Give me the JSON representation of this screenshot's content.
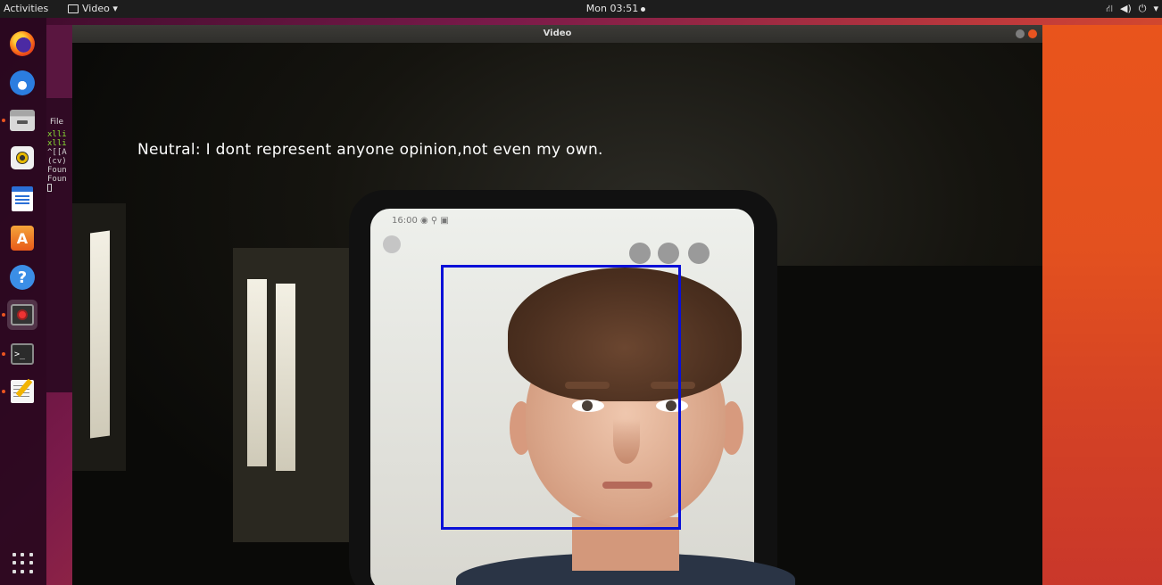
{
  "topbar": {
    "activities": "Activities",
    "app_menu": "Video ▾",
    "clock": "Mon 03:51",
    "tray": {
      "network_icon": "network-icon",
      "volume_icon": "volume-icon",
      "power_icon": "power-icon",
      "power_caret": "▾"
    }
  },
  "dock": {
    "items": [
      "firefox",
      "thunderbird",
      "files",
      "rhythmbox",
      "libreoffice-writer",
      "ubuntu-software",
      "help",
      "video-app",
      "terminal",
      "text-editor"
    ],
    "show_apps": "show-applications"
  },
  "bg_terminal": {
    "menu": "File",
    "lines": [
      "xlli",
      "xlli",
      "^[[A",
      "(cv)",
      "Foun",
      "Foun"
    ]
  },
  "video_window": {
    "title": "Video",
    "caption": "Neutral: I dont represent anyone opinion,not even my own.",
    "phone_status": "16:00 ◉ ⚲ ▣",
    "detection_color": "#0a10d8"
  }
}
